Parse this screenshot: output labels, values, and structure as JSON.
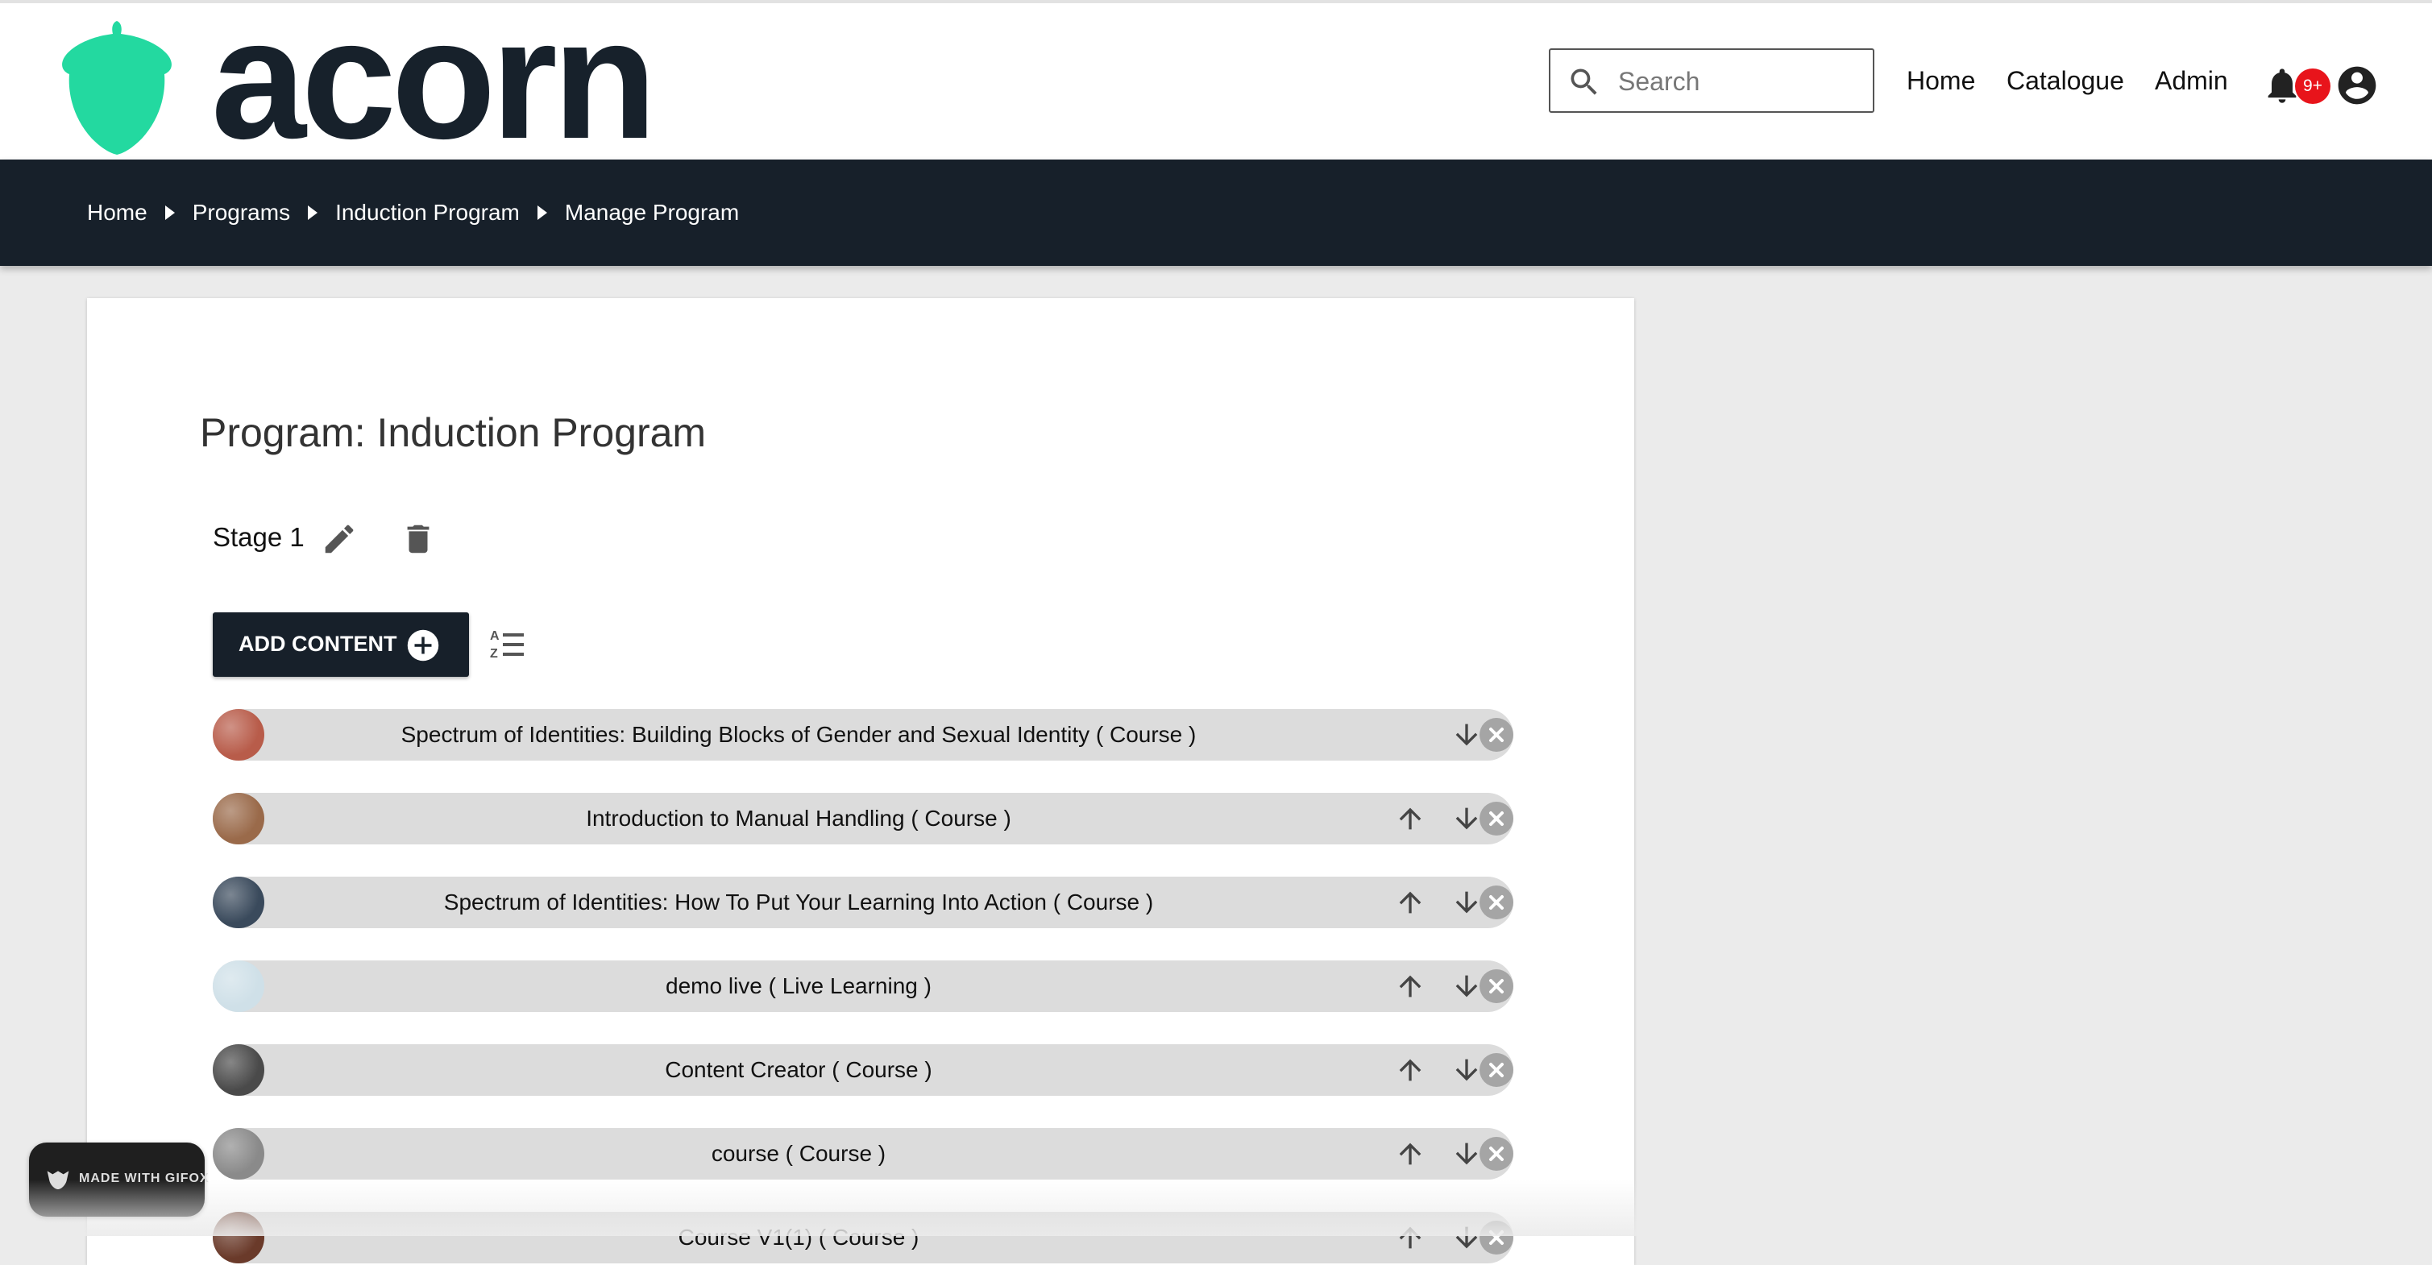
{
  "brand": {
    "name": "acorn",
    "accent": "#23d9a0"
  },
  "search": {
    "placeholder": "Search"
  },
  "nav": {
    "items": [
      "Home",
      "Catalogue",
      "Admin"
    ]
  },
  "notifications": {
    "badge": "9+"
  },
  "breadcrumb": [
    "Home",
    "Programs",
    "Induction Program",
    "Manage Program"
  ],
  "program": {
    "title": "Program: Induction Program",
    "stage": "Stage 1",
    "add_content_label": "ADD CONTENT"
  },
  "content_items": [
    {
      "label": "Spectrum of Identities: Building Blocks of Gender and Sexual Identity ( Course )",
      "thumb": "#b85c4a"
    },
    {
      "label": "Introduction to Manual Handling ( Course )",
      "thumb": "#9a6a4a"
    },
    {
      "label": "Spectrum of Identities: How To Put Your Learning Into Action ( Course )",
      "thumb": "#3a4a5c"
    },
    {
      "label": "demo live ( Live Learning )",
      "thumb": "#cfe0e8"
    },
    {
      "label": "Content Creator ( Course )",
      "thumb": "#4a4a4a"
    },
    {
      "label": "course ( Course )",
      "thumb": "#8a8a8a"
    },
    {
      "label": "Course V1(1) ( Course )",
      "thumb": "#6a3a2a"
    }
  ],
  "watermark": {
    "text": "MADE WITH GIFOX"
  },
  "colors": {
    "header_dark": "#17202a",
    "row_bg": "#dcdcdc",
    "badge": "#e8141b"
  }
}
